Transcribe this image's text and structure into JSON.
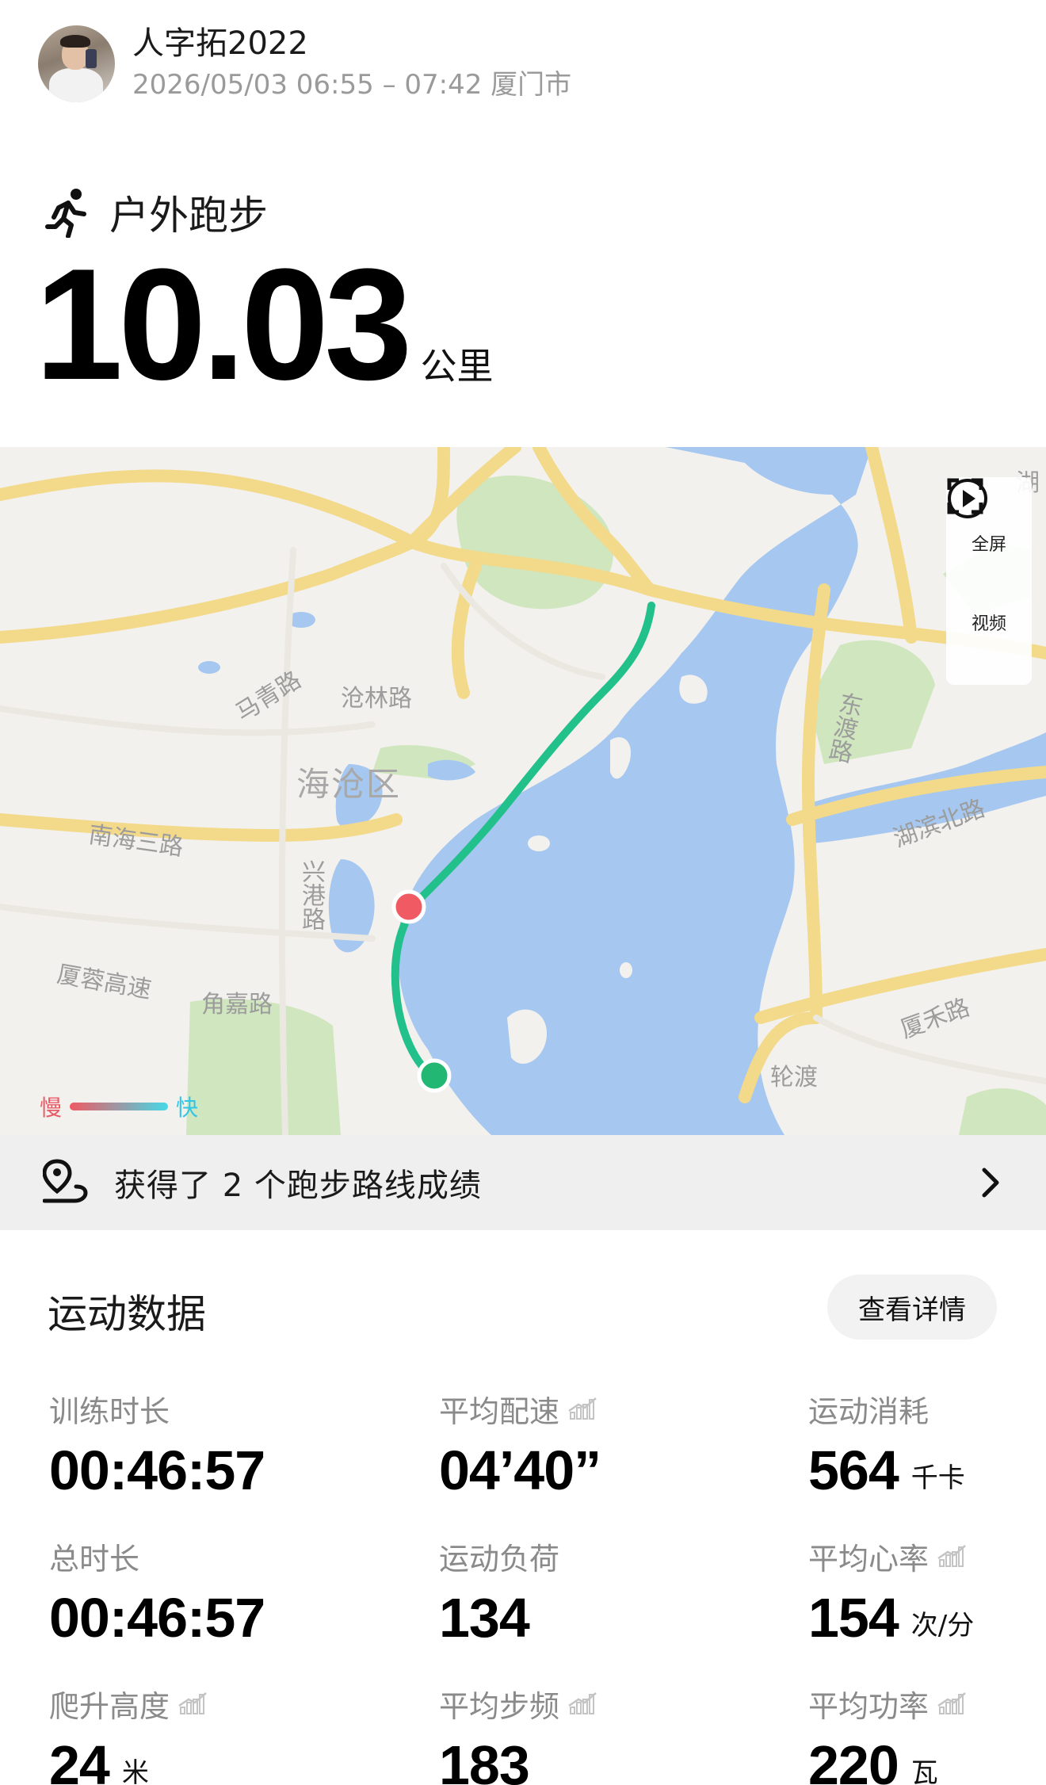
{
  "user": {
    "name": "人字拓2022",
    "meta": "2026/05/03 06:55 – 07:42 厦门市"
  },
  "activity": {
    "type": "户外跑步",
    "icon": "running-person-icon",
    "distance": "10.03",
    "distance_unit": "公里"
  },
  "map": {
    "labels": {
      "district": "海沧区",
      "canglin": "沧林路",
      "maqing": "马青路",
      "nanhai3": "南海三路",
      "xinggang": "兴港路",
      "xiarong": "厦蓉高速",
      "jiaoxi": "角嘉路",
      "dongdu": "东渡路",
      "hubinbei": "湖滨北路",
      "xiahe": "厦禾路",
      "lundu": "轮渡",
      "hu": "湖"
    },
    "controls": {
      "fullscreen": "全屏",
      "video": "视频"
    },
    "legend": {
      "slow": "慢",
      "fast": "快"
    },
    "colors": {
      "water": "#a6c8f0",
      "park": "#cfe6be",
      "road": "#f8dc8a",
      "route": "#22c08a",
      "start": "#22b873",
      "end": "#ef5a63"
    }
  },
  "achievement": {
    "text": "获得了 2 个跑步路线成绩"
  },
  "stats": {
    "title": "运动数据",
    "details_button": "查看详情",
    "items": [
      {
        "label": "训练时长",
        "value": "00:46:57",
        "unit": ""
      },
      {
        "label": "平均配速",
        "value": "04’40”",
        "unit": ""
      },
      {
        "label": "运动消耗",
        "value": "564",
        "unit": "千卡"
      },
      {
        "label": "总时长",
        "value": "00:46:57",
        "unit": ""
      },
      {
        "label": "运动负荷",
        "value": "134",
        "unit": ""
      },
      {
        "label": "平均心率",
        "value": "154",
        "unit": "次/分"
      },
      {
        "label": "爬升高度",
        "value": "24",
        "unit": "米"
      },
      {
        "label": "平均步频",
        "value": "183",
        "unit": ""
      },
      {
        "label": "平均功率",
        "value": "220",
        "unit": "瓦"
      }
    ]
  }
}
